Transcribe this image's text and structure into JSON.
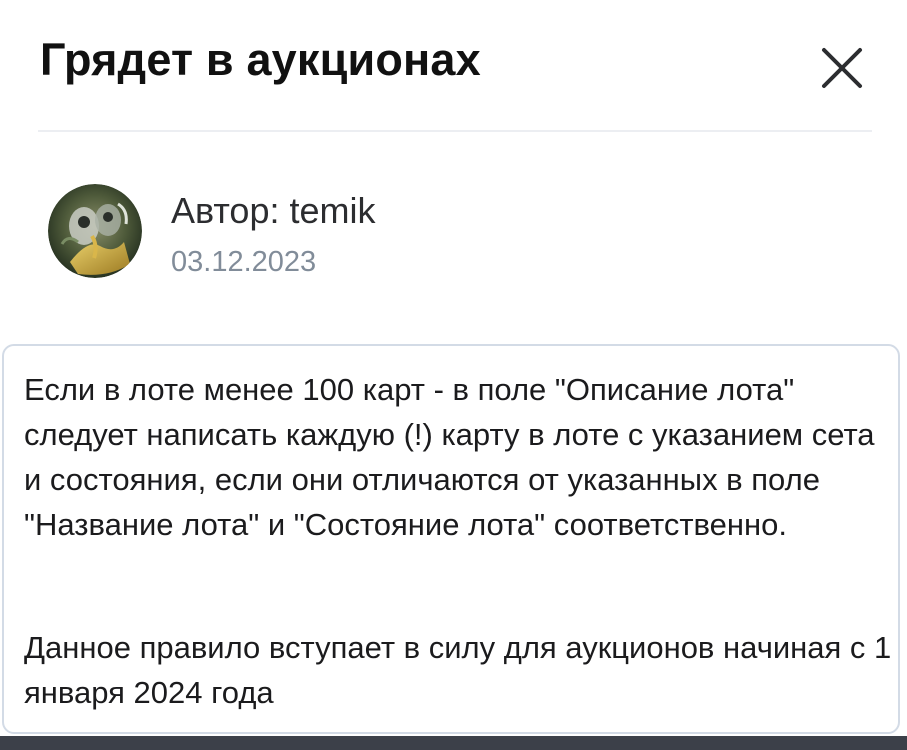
{
  "header": {
    "title": "Грядет в аукционах",
    "close_icon": "close-icon"
  },
  "post": {
    "author_label": "Автор: temik",
    "date": "03.12.2023",
    "avatar_icon": "avatar-image"
  },
  "content": {
    "paragraph_1": "Если в лоте менее 100 карт - в поле \"Описание лота\" следует написать каждую (!) карту в лоте с указанием сета и состояния, если они отличаются от указанных в поле \"Название лота\" и \"Состояние лота\" соответственно.",
    "paragraph_2": "Данное правило вступает в силу для аукционов начиная с 1 января 2024 года"
  },
  "colors": {
    "title": "#111111",
    "author": "#2c2d30",
    "date": "#818c99",
    "card_border": "#d3dbe6",
    "bottom_bar": "#3c4049"
  }
}
